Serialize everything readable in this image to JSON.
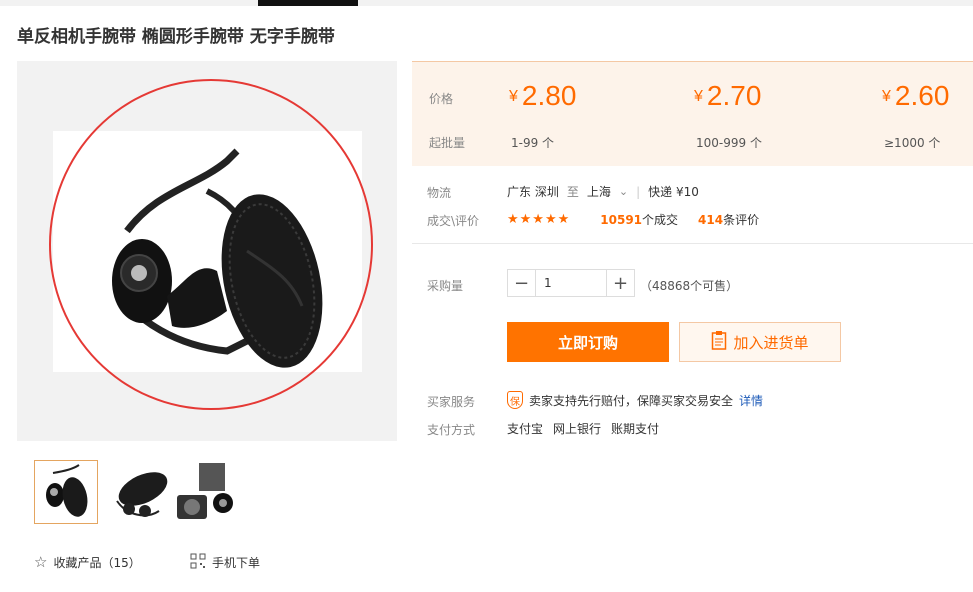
{
  "product": {
    "title": "单反相机手腕带 椭圆形手腕带 无字手腕带"
  },
  "prices": {
    "price_label": "价格",
    "min_order_label": "起批量",
    "currency": "¥",
    "tiers": [
      {
        "price": "2.80",
        "range": "1-99 个"
      },
      {
        "price": "2.70",
        "range": "100-999 个"
      },
      {
        "price": "2.60",
        "range": "≥1000 个"
      }
    ]
  },
  "logistics": {
    "label": "物流",
    "from": "广东 深圳",
    "to_word": "至",
    "to": "上海",
    "shipping": "快递 ¥10"
  },
  "reviews": {
    "label": "成交\\评价",
    "stars": "★★★★★",
    "sales_count": "10591",
    "sales_suffix": "个成交",
    "review_count": "414",
    "review_suffix": "条评价"
  },
  "purchase": {
    "label": "采购量",
    "quantity": "1",
    "minus": "−",
    "plus": "+",
    "stock": "（48868个可售）",
    "buy_now": "立即订购",
    "add_to_cart": "加入进货单"
  },
  "services": {
    "buyer_service_label": "买家服务",
    "badge": "保",
    "guarantee_text": "卖家支持先行赔付，保障买家交易安全",
    "details_link": "详情",
    "payment_label": "支付方式",
    "payment_methods": [
      "支付宝",
      "网上银行",
      "账期支付"
    ]
  },
  "actions": {
    "favorite": "收藏产品（15）",
    "mobile_order": "手机下单"
  },
  "colors": {
    "accent": "#ff6a00",
    "buy_button": "#ff7300",
    "annotation_circle": "#e53935"
  }
}
